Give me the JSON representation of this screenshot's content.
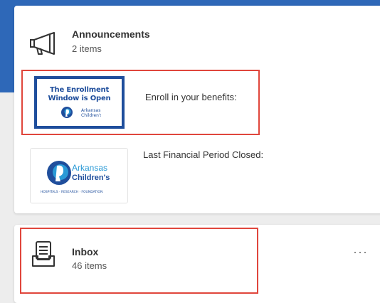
{
  "announcements": {
    "title": "Announcements",
    "count": "2 items",
    "items": [
      {
        "image_text": [
          "The Enrollment",
          "Window is Open"
        ],
        "image_logo": "arkansas-childrens-logo",
        "text": "Enroll in your benefits:"
      },
      {
        "image_logo": "arkansas-childrens-logo",
        "text": "Last Financial Period Closed:"
      }
    ]
  },
  "inbox": {
    "title": "Inbox",
    "count": "46 items",
    "menu_label": "···"
  },
  "logo": {
    "line1": "Arkansas",
    "line2": "Children's",
    "tagline": "HOSPITALS · RESEARCH · FOUNDATION"
  },
  "colors": {
    "band": "#2e68b8",
    "highlight": "#e0463c",
    "brand": "#1f4e9c",
    "brand_light": "#2a9ad6"
  }
}
